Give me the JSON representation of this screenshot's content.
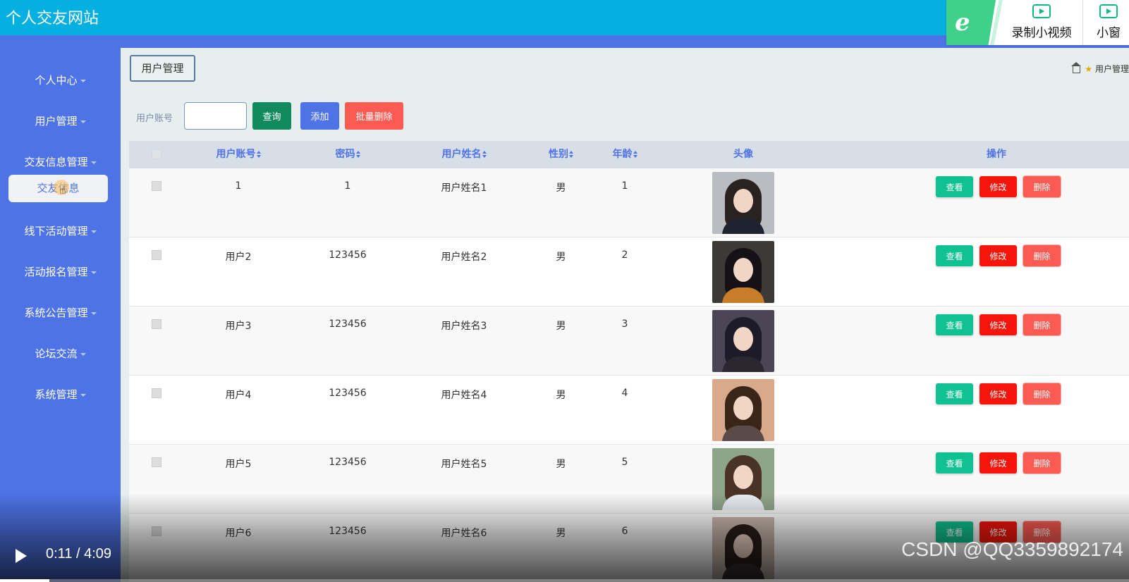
{
  "header": {
    "site_title": "个人交友网站"
  },
  "recorder": {
    "items": [
      "录制小视频",
      "小窗"
    ]
  },
  "sidebar": {
    "items": [
      {
        "label": "个人中心"
      },
      {
        "label": "用户管理"
      },
      {
        "label": "交友信息管理"
      },
      {
        "label": "线下活动管理"
      },
      {
        "label": "活动报名管理"
      },
      {
        "label": "系统公告管理"
      },
      {
        "label": "论坛交流"
      },
      {
        "label": "系统管理"
      }
    ],
    "active_sub": "交友信息"
  },
  "page": {
    "tag": "用户管理",
    "breadcrumb": "用户管理"
  },
  "search": {
    "label": "用户账号",
    "value": "",
    "search_button": "查询",
    "add_button": "添加",
    "batch_delete_button": "批量删除"
  },
  "table": {
    "headers": {
      "account": "用户账号",
      "password": "密码",
      "name": "用户姓名",
      "gender": "性别",
      "age": "年龄",
      "avatar": "头像",
      "actions": "操作"
    },
    "rows": [
      {
        "account": "1",
        "password": "1",
        "name": "用户姓名1",
        "gender": "男",
        "age": "1"
      },
      {
        "account": "用户2",
        "password": "123456",
        "name": "用户姓名2",
        "gender": "男",
        "age": "2"
      },
      {
        "account": "用户3",
        "password": "123456",
        "name": "用户姓名3",
        "gender": "男",
        "age": "3"
      },
      {
        "account": "用户4",
        "password": "123456",
        "name": "用户姓名4",
        "gender": "男",
        "age": "4"
      },
      {
        "account": "用户5",
        "password": "123456",
        "name": "用户姓名5",
        "gender": "男",
        "age": "5"
      },
      {
        "account": "用户6",
        "password": "123456",
        "name": "用户姓名6",
        "gender": "男",
        "age": "6"
      }
    ],
    "action_labels": {
      "view": "查看",
      "edit": "修改",
      "delete": "删除"
    }
  },
  "video": {
    "time": "0:11 / 4:09",
    "progress": 0.044,
    "watermark": "CSDN @QQ3359892174"
  },
  "colors": {
    "header": "#04b0df",
    "sidebar": "#4e73e6",
    "view": "#10c291",
    "edit": "#f5150b",
    "delete": "#fb5b52"
  }
}
